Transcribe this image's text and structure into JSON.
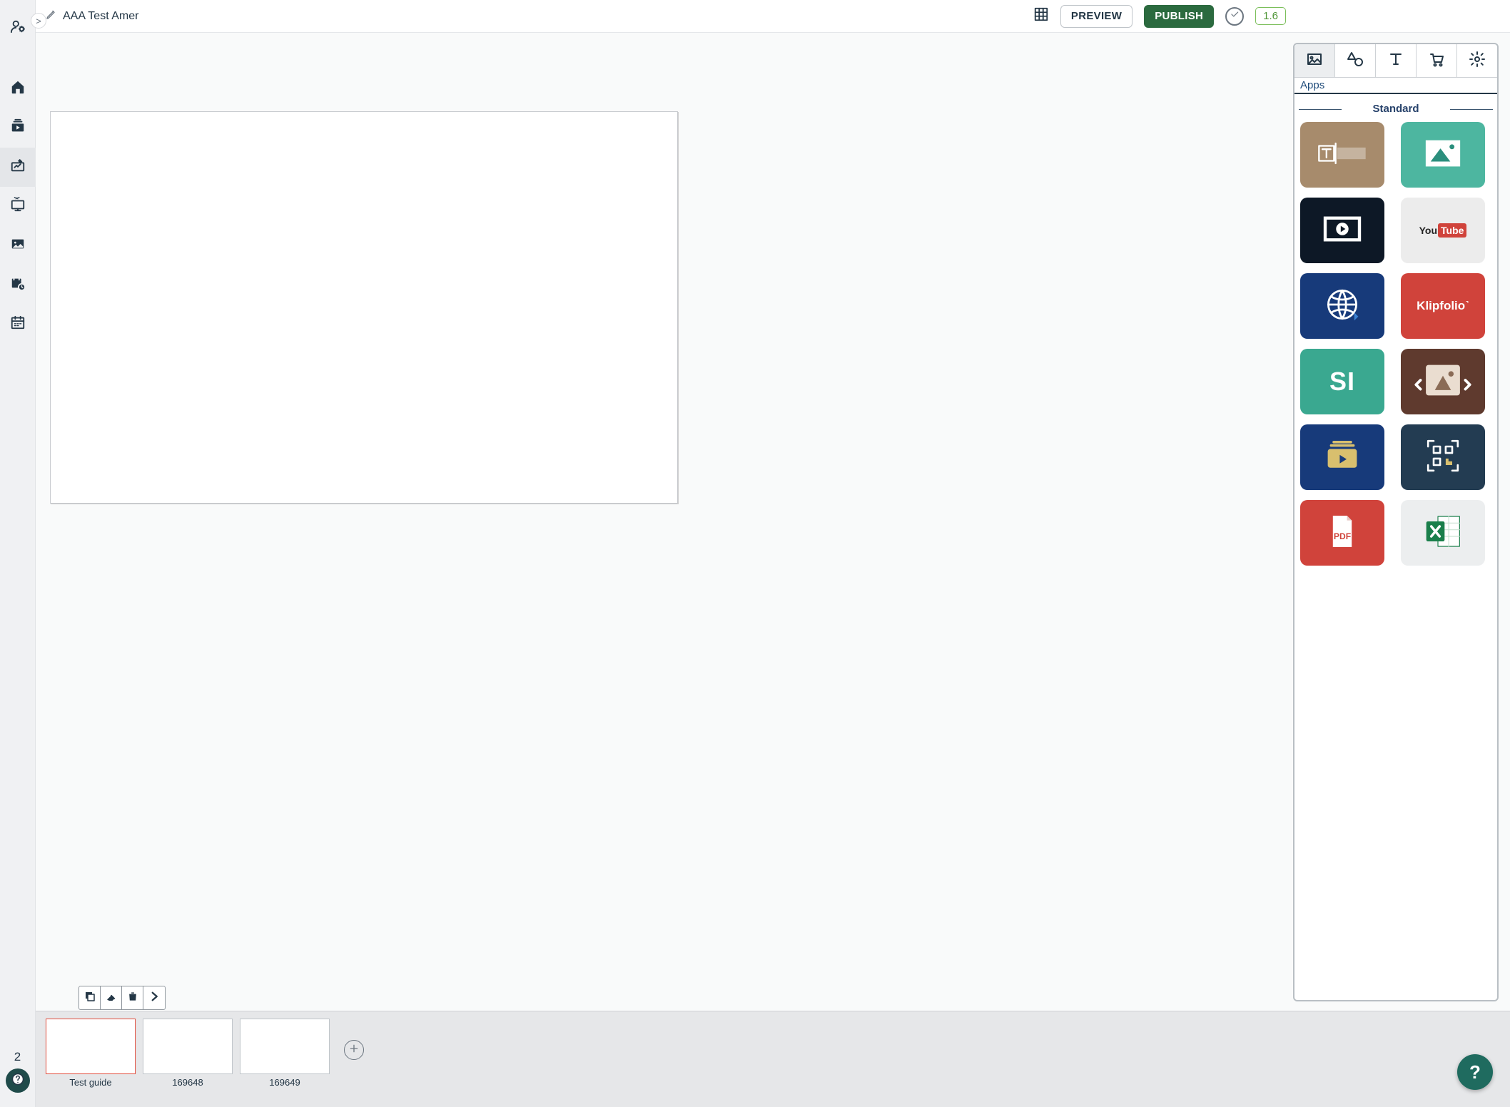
{
  "sidebar": {
    "toggle": ">",
    "items": [
      {
        "name": "admin",
        "icon": "user-gear-icon"
      },
      {
        "name": "home",
        "icon": "home-icon"
      },
      {
        "name": "playlists",
        "icon": "playlist-icon"
      },
      {
        "name": "compose",
        "icon": "compose-icon",
        "active": true
      },
      {
        "name": "screens",
        "icon": "screen-icon"
      },
      {
        "name": "media",
        "icon": "picture-icon"
      },
      {
        "name": "schedule",
        "icon": "calendar-clock-icon"
      },
      {
        "name": "calendar",
        "icon": "calendar-icon"
      }
    ],
    "footer_number": "2"
  },
  "topbar": {
    "title": "AAA Test Amer",
    "preview": "PREVIEW",
    "publish": "PUBLISH",
    "version": "1.6"
  },
  "right_panel": {
    "sub_label": "Apps",
    "section": "Standard",
    "apps": [
      {
        "name": "text-app",
        "bg": "bg-brown"
      },
      {
        "name": "image-app",
        "bg": "bg-teal"
      },
      {
        "name": "video-app",
        "bg": "bg-dark"
      },
      {
        "name": "youtube-app",
        "bg": "bg-light",
        "label_html": "youtube"
      },
      {
        "name": "web-app",
        "bg": "bg-navy"
      },
      {
        "name": "klipfolio-app",
        "bg": "bg-red",
        "label": "Klipfolio˺"
      },
      {
        "name": "si-app",
        "bg": "bg-teal2",
        "label": "SI"
      },
      {
        "name": "carousel-app",
        "bg": "bg-brown2"
      },
      {
        "name": "playlist-app",
        "bg": "bg-navy"
      },
      {
        "name": "qr-app",
        "bg": "bg-slate"
      },
      {
        "name": "pdf-app",
        "bg": "bg-red",
        "label": "PDF"
      },
      {
        "name": "excel-app",
        "bg": "bg-grey"
      }
    ]
  },
  "slides": [
    {
      "label": "Test guide",
      "selected": true
    },
    {
      "label": "169648",
      "selected": false
    },
    {
      "label": "169649",
      "selected": false
    }
  ],
  "help_bubble": "?"
}
